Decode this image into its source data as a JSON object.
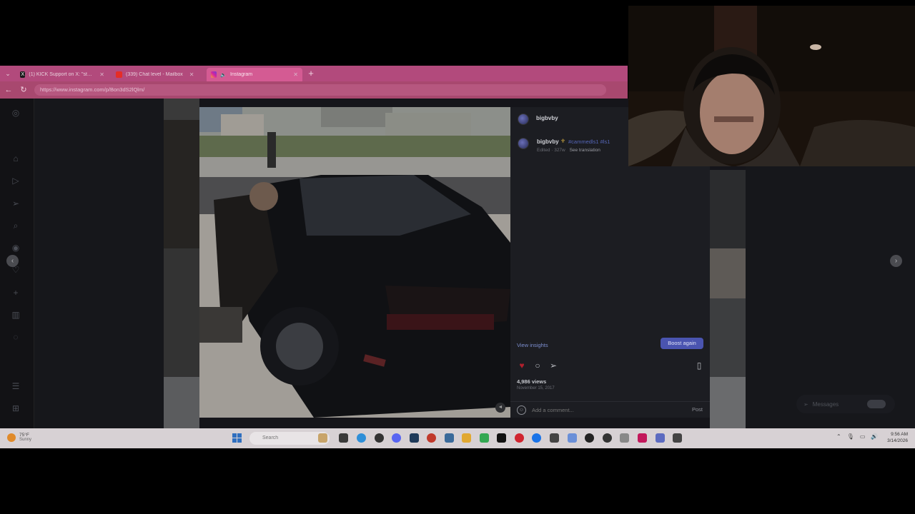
{
  "browser": {
    "tabs": [
      {
        "label": "(1) KICK Support on X: \"standard...",
        "favicon": "x-icon",
        "color": "#000000",
        "active": false
      },
      {
        "label": "(339) Chat level - Mailbox",
        "favicon": "youtube-icon",
        "color": "#e52d27",
        "active": false
      },
      {
        "label": "Instagram",
        "favicon": "instagram-icon",
        "color": "#d6249f",
        "active": true
      }
    ],
    "new_tab": "+",
    "url": "https://www.instagram.com/p/Bon3dS2lQlm/",
    "accent": "#d45b93"
  },
  "instagram": {
    "sidebar_icons": [
      "instagram-logo-icon",
      "home-icon",
      "reels-icon",
      "send-icon",
      "search-icon",
      "explore-icon",
      "heart-icon",
      "create-icon",
      "dashboard-icon",
      "profile-icon",
      "menu-icon",
      "more-icon"
    ],
    "post": {
      "header_username": "bigbvby",
      "caption_username": "bigbvby",
      "caption_tags": "#cammedls1 #ls1",
      "meta_edited": "Edited · 327w",
      "meta_translate": "See translation",
      "view_insights": "View insights",
      "boost_label": "Boost again",
      "views": "4,986 views",
      "date": "November 15, 2017",
      "comment_placeholder": "Add a comment...",
      "post_label": "Post"
    },
    "messages_label": "Messages"
  },
  "taskbar": {
    "weather_temp": "75°F",
    "weather_cond": "Sunny",
    "search_placeholder": "Search",
    "time": "9:56 AM",
    "date": "3/14/2026"
  }
}
